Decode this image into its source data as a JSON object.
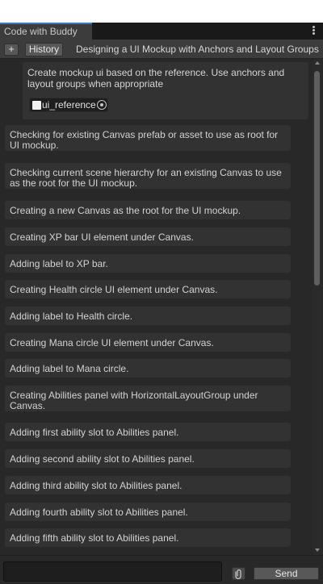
{
  "window": {
    "tab_label": "Code with Buddy"
  },
  "toolbar": {
    "new_label": "+",
    "history_label": "History",
    "conversation_title": "Designing a UI Mockup with Anchors and Layout Groups"
  },
  "user_message": {
    "text": "Create mockup ui based on the reference. Use anchors and layout groups when appropriate",
    "attachment": "ui_reference"
  },
  "steps": [
    "Checking for existing Canvas prefab or asset to use as root for UI mockup.",
    "Checking current scene hierarchy for an existing Canvas to use as the root for the UI mockup.",
    "Creating a new Canvas as the root for the UI mockup.",
    "Creating XP bar UI element under Canvas.",
    "Adding label to XP bar.",
    "Creating Health circle UI element under Canvas.",
    "Adding label to Health circle.",
    "Creating Mana circle UI element under Canvas.",
    "Adding label to Mana circle.",
    "Creating Abilities panel with HorizontalLayoutGroup under Canvas.",
    "Adding first ability slot to Abilities panel.",
    "Adding second ability slot to Abilities panel.",
    "Adding third ability slot to Abilities panel.",
    "Adding fourth ability slot to Abilities panel.",
    "Adding fifth ability slot to Abilities panel."
  ],
  "footer": {
    "input_value": "",
    "input_placeholder": "",
    "send_label": "Send",
    "attach_icon": "paperclip-icon"
  },
  "colors": {
    "panel_bg": "#282828",
    "card_bg": "#323232",
    "accent": "#3a79bb"
  }
}
